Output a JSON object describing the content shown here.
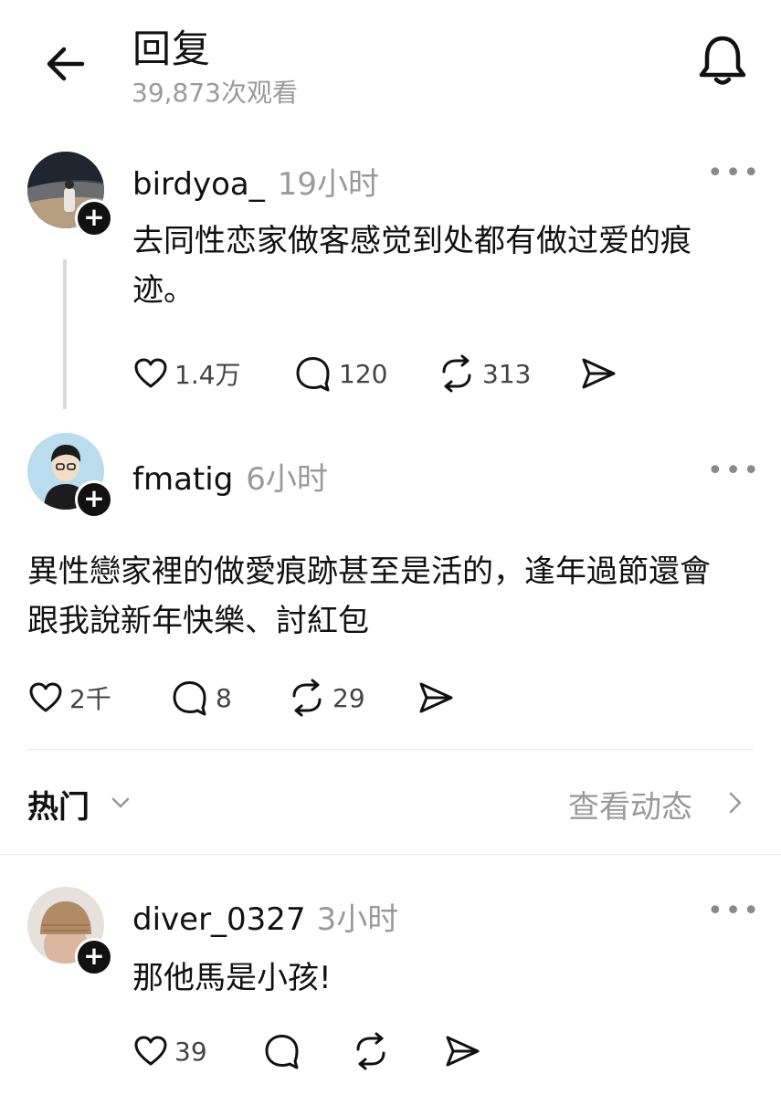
{
  "header": {
    "title": "回复",
    "views": "39,873次观看",
    "back_icon": "arrow-left-icon",
    "bell_icon": "bell-icon"
  },
  "main_post": {
    "username": "birdyoa_",
    "time": "19小时",
    "text": "去同性恋家做客感觉到处都有做过爱的痕迹。",
    "likes": "1.4万",
    "comments": "120",
    "reposts": "313"
  },
  "reply": {
    "username": "fmatig",
    "time": "6小时",
    "text": "異性戀家裡的做愛痕跡甚至是活的，逢年過節還會跟我說新年快樂、討紅包",
    "likes": "2千",
    "comments": "8",
    "reposts": "29"
  },
  "sort_bar": {
    "label": "热门",
    "activity_link": "查看动态"
  },
  "comment": {
    "username": "diver_0327",
    "time": "3小时",
    "text": "那他馬是小孩!",
    "likes": "39"
  },
  "more_label": "•••",
  "plus_label": "+"
}
